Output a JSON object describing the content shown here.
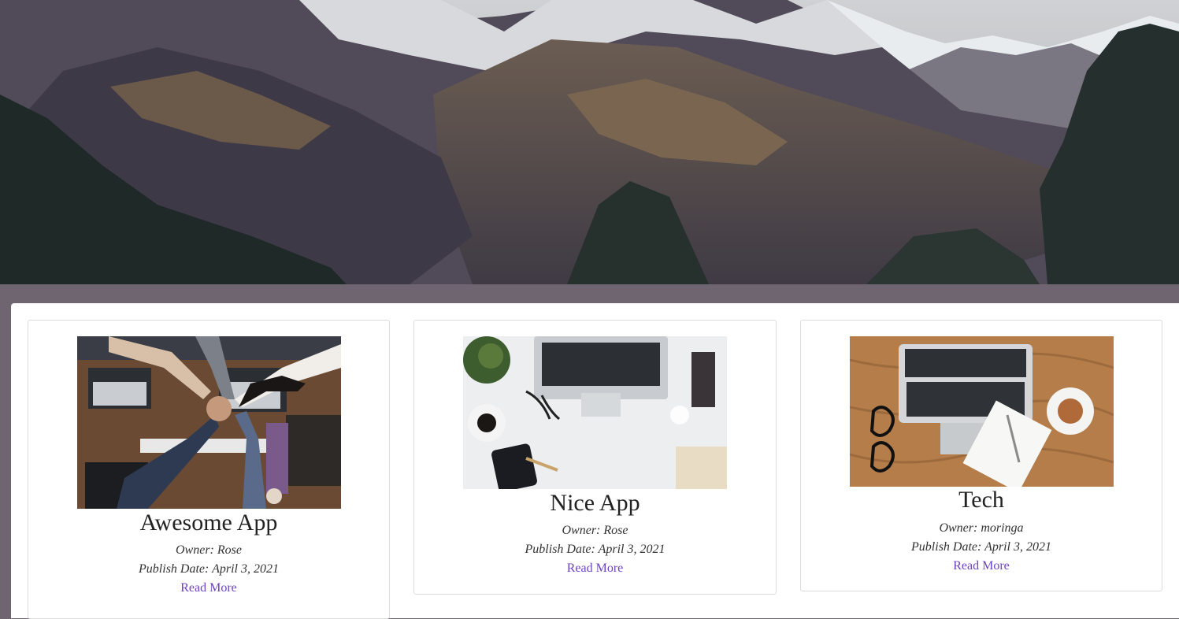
{
  "hero": {
    "image": "mountain-landscape"
  },
  "colors": {
    "page_background": "#6e6570",
    "card_background": "#ffffff",
    "link": "#6f42c1"
  },
  "projects": [
    {
      "title": "Awesome App",
      "owner": "Owner: Rose",
      "publish_date": "Publish Date: April 3, 2021",
      "link_label": "Read More",
      "image": "team-hands-laptops-photo"
    },
    {
      "title": "Nice App",
      "owner": "Owner: Rose",
      "publish_date": "Publish Date: April 3, 2021",
      "link_label": "Read More",
      "image": "white-desk-laptop-photo"
    },
    {
      "title": "Tech",
      "owner": "Owner: moringa",
      "publish_date": "Publish Date: April 3, 2021",
      "link_label": "Read More",
      "image": "wood-desk-laptop-coffee-photo"
    }
  ]
}
